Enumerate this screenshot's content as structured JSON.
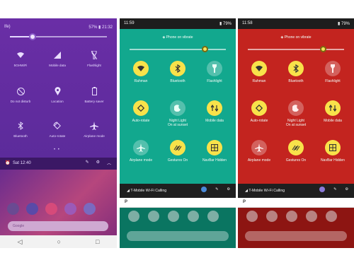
{
  "panel1": {
    "status_left": "Ife)",
    "status_battery": "57%",
    "status_time": "21:32",
    "tiles": [
      {
        "label": "5GHWiFi",
        "icon": "wifi-icon"
      },
      {
        "label": "Mobile data",
        "icon": "mobile-data-icon"
      },
      {
        "label": "Flashlight",
        "icon": "flashlight-icon"
      },
      {
        "label": "Do not disturb",
        "icon": "do-not-disturb-icon"
      },
      {
        "label": "Location",
        "icon": "location-icon"
      },
      {
        "label": "Battery saver",
        "icon": "battery-saver-icon"
      },
      {
        "label": "Bluetooth",
        "icon": "bluetooth-icon"
      },
      {
        "label": "Auto-rotate",
        "icon": "auto-rotate-icon"
      },
      {
        "label": "Airplane mode",
        "icon": "airplane-icon"
      }
    ],
    "footer_date": "Sat 12:40",
    "search_placeholder": "Google"
  },
  "panel2": {
    "status_time": "11:59",
    "status_battery": "79%",
    "vibrate_label": "Phone on vibrate",
    "tiles": [
      {
        "label": "Rahman",
        "sub": "",
        "state": "on",
        "icon": "wifi-icon"
      },
      {
        "label": "Bluetooth",
        "sub": "",
        "state": "on",
        "icon": "bluetooth-icon"
      },
      {
        "label": "Flashlight",
        "sub": "",
        "state": "off",
        "icon": "flashlight-icon"
      },
      {
        "label": "Auto-rotate",
        "sub": "",
        "state": "on",
        "icon": "auto-rotate-icon"
      },
      {
        "label": "Night Light",
        "sub": "On at sunset",
        "state": "off",
        "icon": "moon-icon"
      },
      {
        "label": "Mobile data",
        "sub": "",
        "state": "on",
        "icon": "mobile-data-icon"
      },
      {
        "label": "Airplane mode",
        "sub": "",
        "state": "off",
        "icon": "airplane-icon"
      },
      {
        "label": "Gestures On",
        "sub": "",
        "state": "on",
        "icon": "gestures-icon"
      },
      {
        "label": "NavBar Hidden",
        "sub": "",
        "state": "on",
        "icon": "navbar-icon"
      }
    ],
    "footer_label": "T-Mobile Wi-Fi Calling",
    "search_text": "P"
  },
  "panel3": {
    "status_time": "11:58",
    "status_battery": "79%",
    "vibrate_label": "Phone on vibrate",
    "tiles": [
      {
        "label": "Rahman",
        "sub": "",
        "state": "on",
        "icon": "wifi-icon"
      },
      {
        "label": "Bluetooth",
        "sub": "",
        "state": "on",
        "icon": "bluetooth-icon"
      },
      {
        "label": "Flashlight",
        "sub": "",
        "state": "off",
        "icon": "flashlight-icon"
      },
      {
        "label": "Auto-rotate",
        "sub": "",
        "state": "on",
        "icon": "auto-rotate-icon"
      },
      {
        "label": "Night Light",
        "sub": "On at sunset",
        "state": "off",
        "icon": "moon-icon"
      },
      {
        "label": "Mobile data",
        "sub": "",
        "state": "on",
        "icon": "mobile-data-icon"
      },
      {
        "label": "Airplane mode",
        "sub": "",
        "state": "off",
        "icon": "airplane-icon"
      },
      {
        "label": "Gestures On",
        "sub": "",
        "state": "on",
        "icon": "gestures-icon"
      },
      {
        "label": "NavBar Hidden",
        "sub": "",
        "state": "on",
        "icon": "navbar-icon"
      }
    ],
    "footer_label": "T-Mobile Wi-Fi Calling",
    "search_text": "P"
  },
  "colors": {
    "purple": "#5a2a8a",
    "teal": "#12a88e",
    "red": "#c3241f",
    "tile_on": "#f8e24a"
  }
}
